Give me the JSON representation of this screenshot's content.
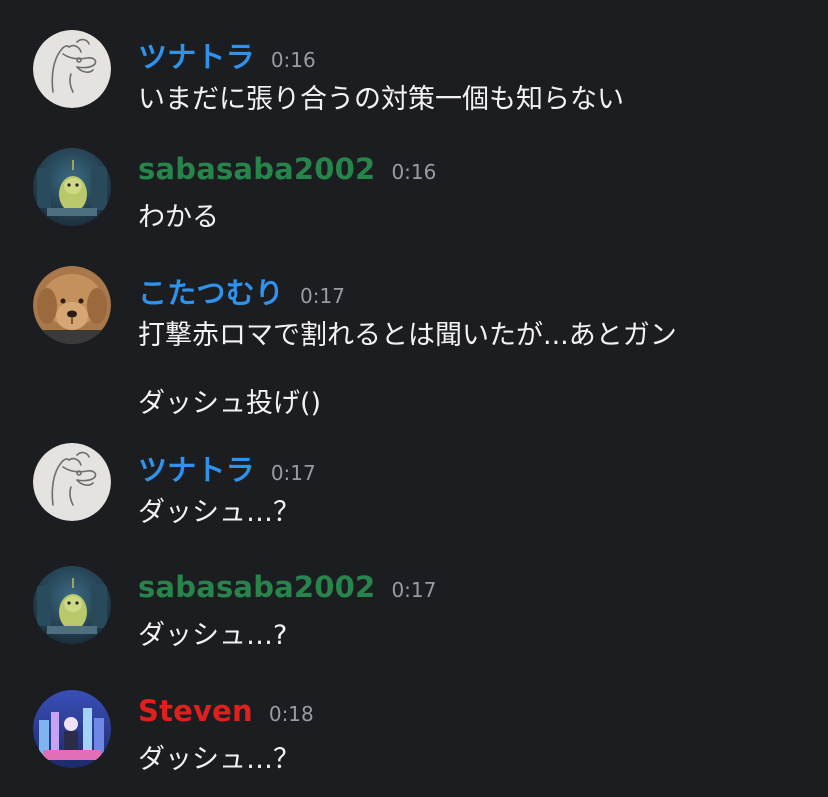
{
  "colors": {
    "background": "#1c1d21",
    "name_blue": "#2e93ec",
    "name_green": "#27844b",
    "name_red": "#e0201c",
    "timestamp": "#9a9ba1",
    "text": "#f2f2f4"
  },
  "messages": [
    {
      "author": "ツナトラ",
      "author_color": "#2e93ec",
      "time": "0:16",
      "avatar_icon": "tunatora-doodle-avatar",
      "lines": [
        "いまだに張り合うの対策一個も知らない"
      ]
    },
    {
      "author": "sabasaba2002",
      "author_color": "#27844b",
      "time": "0:16",
      "avatar_icon": "green-character-avatar",
      "lines": [
        "わかる"
      ]
    },
    {
      "author": "こたつむり",
      "author_color": "#2e93ec",
      "time": "0:17",
      "avatar_icon": "dog-photo-avatar",
      "lines": [
        "打撃赤ロマで割れるとは聞いたが...あとガン",
        "ダッシュ投げ()"
      ]
    },
    {
      "author": "ツナトラ",
      "author_color": "#2e93ec",
      "time": "0:17",
      "avatar_icon": "tunatora-doodle-avatar",
      "lines": [
        "ダッシュ…？"
      ]
    },
    {
      "author": "sabasaba2002",
      "author_color": "#27844b",
      "time": "0:17",
      "avatar_icon": "green-character-avatar",
      "lines": [
        "ダッシュ…?"
      ]
    },
    {
      "author": "Steven",
      "author_color": "#e0201c",
      "time": "0:18",
      "avatar_icon": "city-art-avatar",
      "lines": [
        "ダッシュ…？"
      ]
    }
  ]
}
